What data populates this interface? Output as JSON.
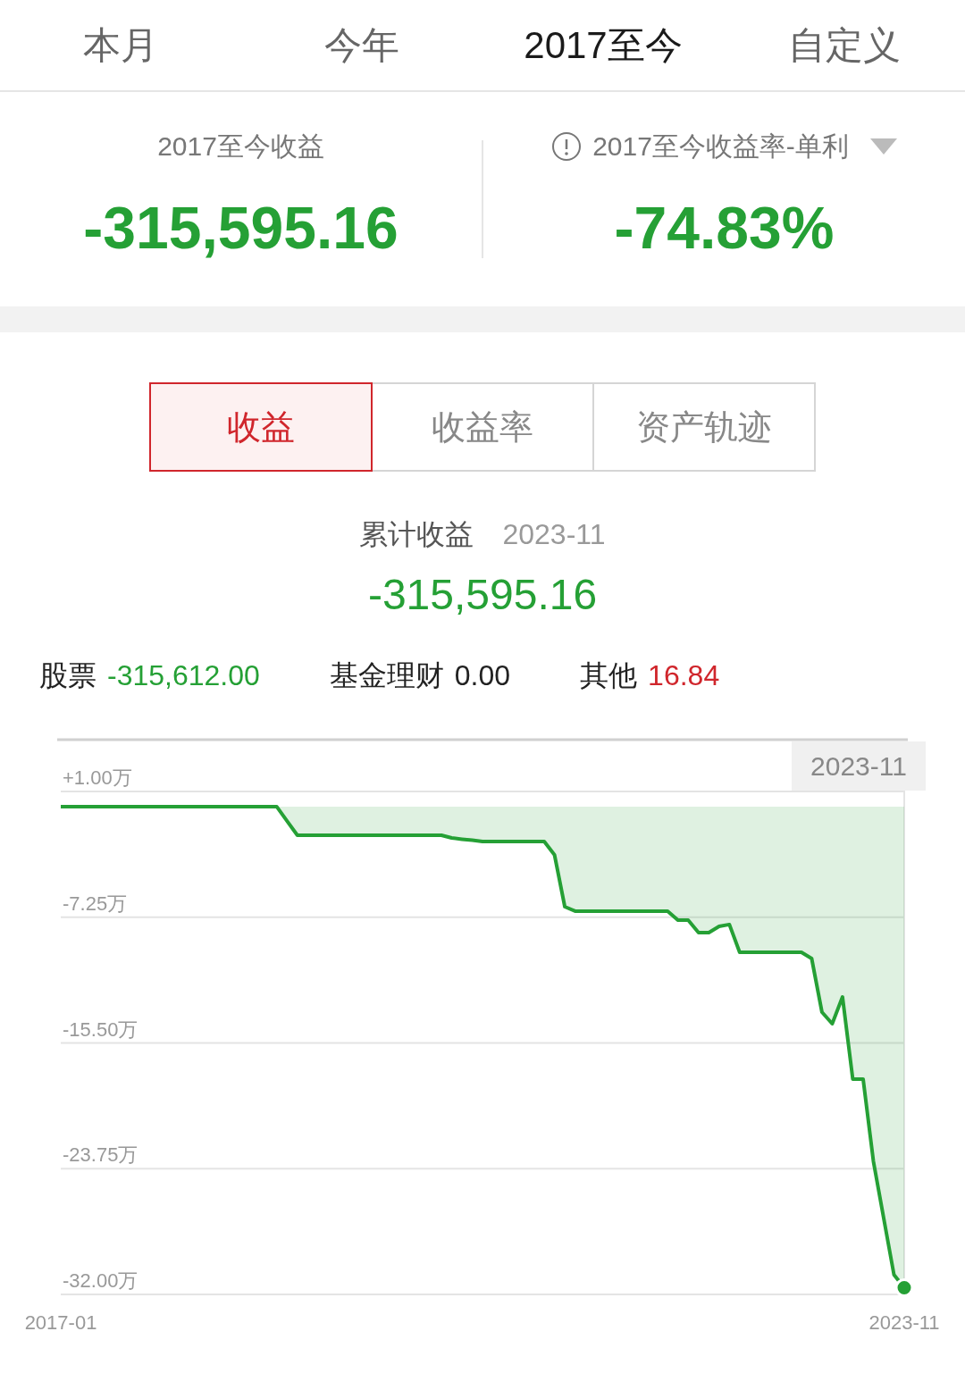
{
  "period_tabs": [
    {
      "label": "本月",
      "selected": false
    },
    {
      "label": "今年",
      "selected": false
    },
    {
      "label": "2017至今",
      "selected": true
    },
    {
      "label": "自定义",
      "selected": false
    }
  ],
  "summary": {
    "profit_label": "2017至今收益",
    "profit_value": "-315,595.16",
    "rate_label": "2017至今收益率-单利",
    "rate_value": "-74.83%"
  },
  "view_tabs": [
    {
      "label": "收益",
      "selected": true
    },
    {
      "label": "收益率",
      "selected": false
    },
    {
      "label": "资产轨迹",
      "selected": false
    }
  ],
  "cumulative": {
    "label": "累计收益",
    "date": "2023-11",
    "value": "-315,595.16"
  },
  "breakdown": [
    {
      "label": "股票",
      "value": "-315,612.00",
      "color": "#25a035"
    },
    {
      "label": "基金理财",
      "value": "0.00",
      "color": "#222222"
    },
    {
      "label": "其他",
      "value": "16.84",
      "color": "#d0262c"
    }
  ],
  "chart": {
    "tooltip": "2023-11",
    "chart_data": {
      "type": "area",
      "categories": [
        "2017-01",
        null,
        null,
        null,
        null,
        null,
        null,
        null,
        null,
        null,
        null,
        null,
        null,
        null,
        null,
        null,
        null,
        null,
        null,
        null,
        null,
        null,
        null,
        null,
        null,
        null,
        null,
        null,
        null,
        null,
        null,
        null,
        null,
        null,
        null,
        null,
        null,
        null,
        null,
        null,
        null,
        null,
        null,
        null,
        null,
        null,
        null,
        null,
        null,
        null,
        null,
        null,
        null,
        null,
        null,
        null,
        null,
        null,
        null,
        null,
        null,
        null,
        null,
        null,
        null,
        null,
        null,
        null,
        null,
        null,
        null,
        null,
        null,
        null,
        null,
        null,
        null,
        null,
        null,
        null,
        null,
        null,
        "2023-11"
      ],
      "series": [
        {
          "color": "#25a035",
          "values": [
            0,
            0,
            0,
            0,
            0,
            0,
            0,
            0,
            0,
            0,
            0,
            0,
            0,
            0,
            0,
            0,
            0,
            0,
            0,
            0,
            0,
            0,
            -0.94,
            -1.87,
            -1.87,
            -1.87,
            -1.87,
            -1.87,
            -1.87,
            -1.87,
            -1.87,
            -1.87,
            -1.87,
            -1.87,
            -1.87,
            -1.87,
            -1.87,
            -1.87,
            -2.05,
            -2.13,
            -2.2,
            -2.28,
            -2.28,
            -2.28,
            -2.28,
            -2.28,
            -2.28,
            -2.28,
            -3.16,
            -6.56,
            -6.85,
            -6.85,
            -6.85,
            -6.85,
            -6.85,
            -6.85,
            -6.85,
            -6.85,
            -6.85,
            -6.85,
            -7.44,
            -7.44,
            -8.26,
            -8.26,
            -7.85,
            -7.73,
            -9.55,
            -9.55,
            -9.55,
            -9.55,
            -9.55,
            -9.55,
            -9.55,
            -9.96,
            -13.48,
            -14.24,
            -12.48,
            -17.87,
            -17.87,
            -23.27,
            -27.0,
            -30.71,
            -31.56
          ]
        }
      ],
      "grid": true,
      "ylim": [
        -32,
        1
      ],
      "yticks": [
        {
          "value": 1,
          "label": "+1.00万"
        },
        {
          "value": -7.25,
          "label": "-7.25万"
        },
        {
          "value": -15.5,
          "label": "-15.50万"
        },
        {
          "value": -23.75,
          "label": "-23.75万"
        },
        {
          "value": -32,
          "label": "-32.00万"
        }
      ]
    }
  }
}
